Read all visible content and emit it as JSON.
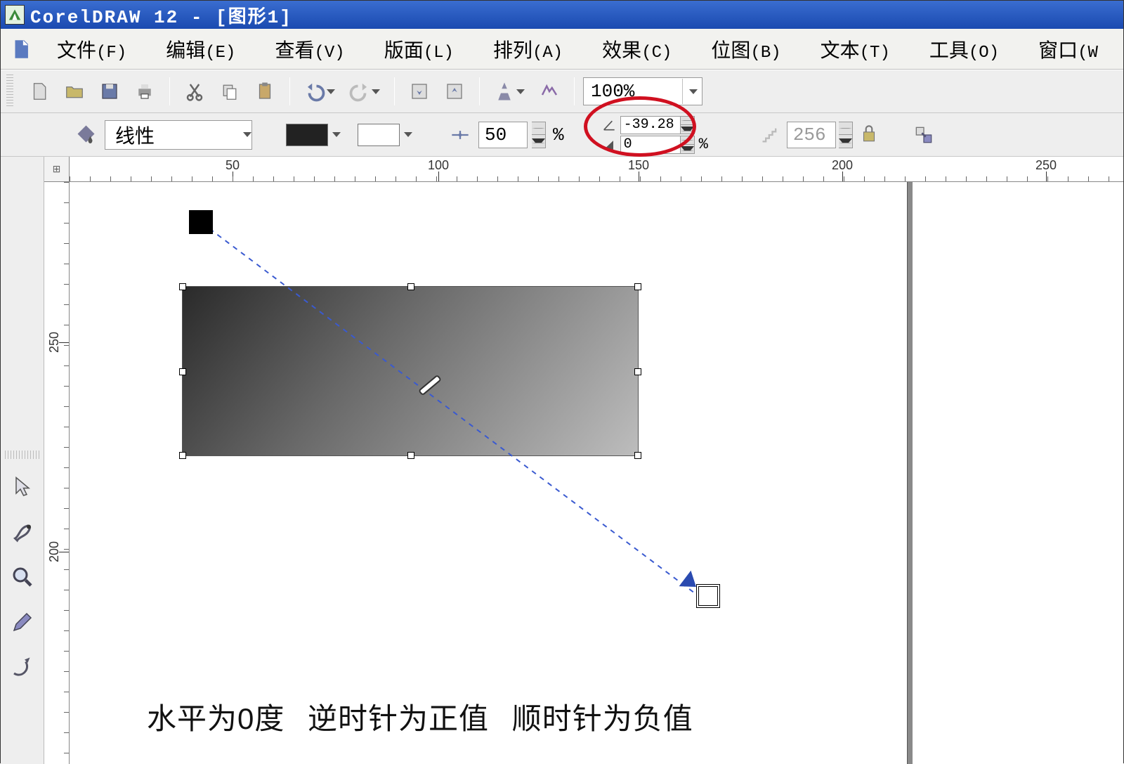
{
  "title": "CorelDRAW 12 - [图形1]",
  "menu": {
    "file": "文件",
    "fileKey": "(F)",
    "edit": "编辑",
    "editKey": "(E)",
    "view": "查看",
    "viewKey": "(V)",
    "layout": "版面",
    "layoutKey": "(L)",
    "arrange": "排列",
    "arrangeKey": "(A)",
    "effects": "效果",
    "effectsKey": "(C)",
    "bitmap": "位图",
    "bitmapKey": "(B)",
    "text": "文本",
    "textKey": "(T)",
    "tools": "工具",
    "toolsKey": "(O)",
    "window": "窗口",
    "windowKey": "(W"
  },
  "toolbar": {
    "zoom": "100%"
  },
  "propbar": {
    "fillType": "线性",
    "midpoint": "50",
    "angle": "-39.28",
    "pad": "0",
    "steps": "256"
  },
  "ruler": {
    "hLabels": [
      "50",
      "100",
      "150",
      "200",
      "250"
    ],
    "hPositions": [
      232,
      525,
      810,
      1100,
      1390
    ],
    "vLabels": [
      "250",
      "200"
    ],
    "vPositions": [
      228,
      526
    ]
  },
  "annotation": {
    "p1": "水平为0度",
    "p2": "逆时针为正值",
    "p3": "顺时针为负值"
  },
  "rulerCorner": "⊞"
}
